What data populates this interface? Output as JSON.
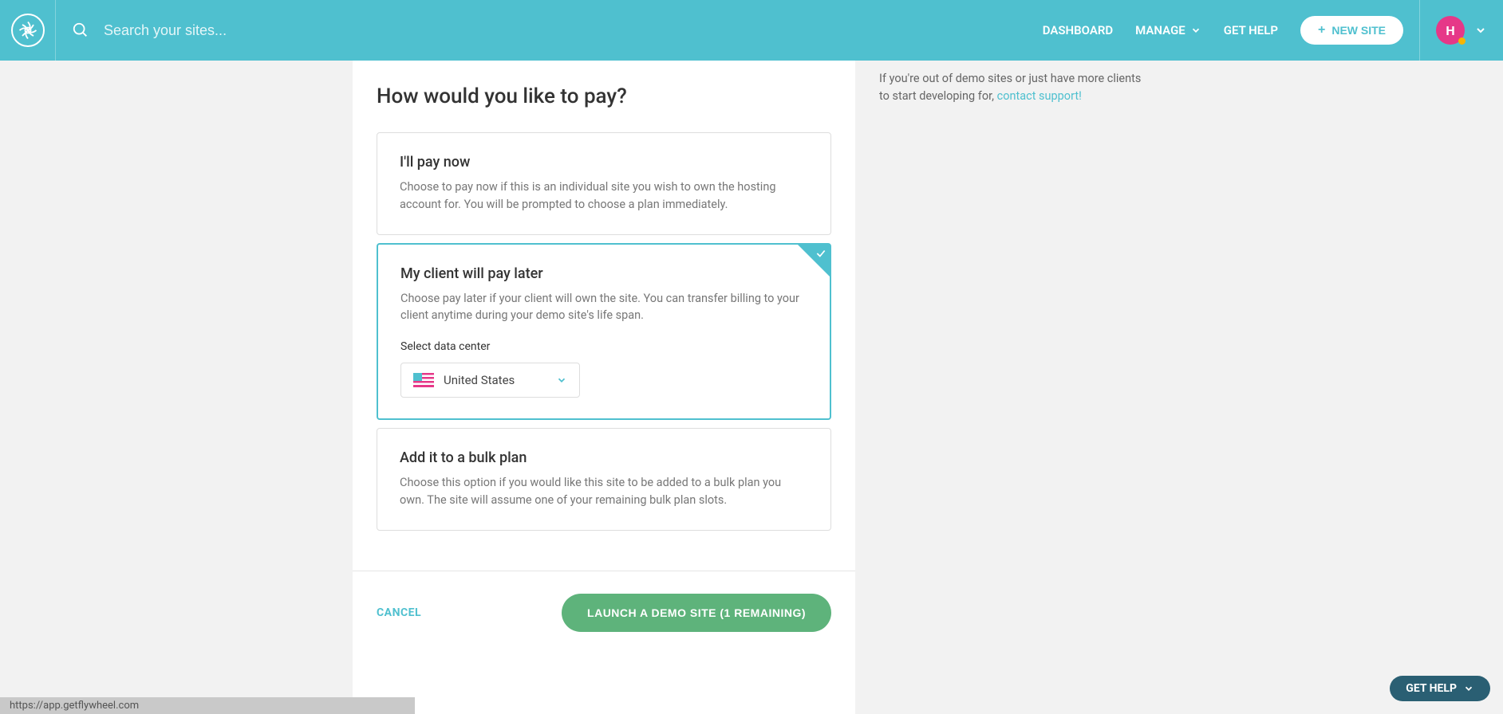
{
  "header": {
    "search_placeholder": "Search your sites...",
    "nav": {
      "dashboard": "DASHBOARD",
      "manage": "MANAGE",
      "get_help": "GET HELP",
      "new_site": "NEW SITE"
    },
    "avatar_initial": "H"
  },
  "main": {
    "question": "How would you like to pay?",
    "options": [
      {
        "title": "I'll pay now",
        "desc": "Choose to pay now if this is an individual site you wish to own the hosting account for. You will be prompted to choose a plan immediately."
      },
      {
        "title": "My client will pay later",
        "desc": "Choose pay later if your client will own the site. You can transfer billing to your client anytime during your demo site's life span.",
        "dc_label": "Select data center",
        "dc_value": "United States"
      },
      {
        "title": "Add it to a bulk plan",
        "desc": "Choose this option if you would like this site to be added to a bulk plan you own. The site will assume one of your remaining bulk plan slots."
      }
    ],
    "cancel": "CANCEL",
    "launch": "LAUNCH A DEMO SITE (1 REMAINING)"
  },
  "side": {
    "text_prefix": "If you're out of demo sites or just have more clients to start developing for, ",
    "link": "contact support!"
  },
  "status_url": "https://app.getflywheel.com",
  "help_pill": "GET HELP"
}
